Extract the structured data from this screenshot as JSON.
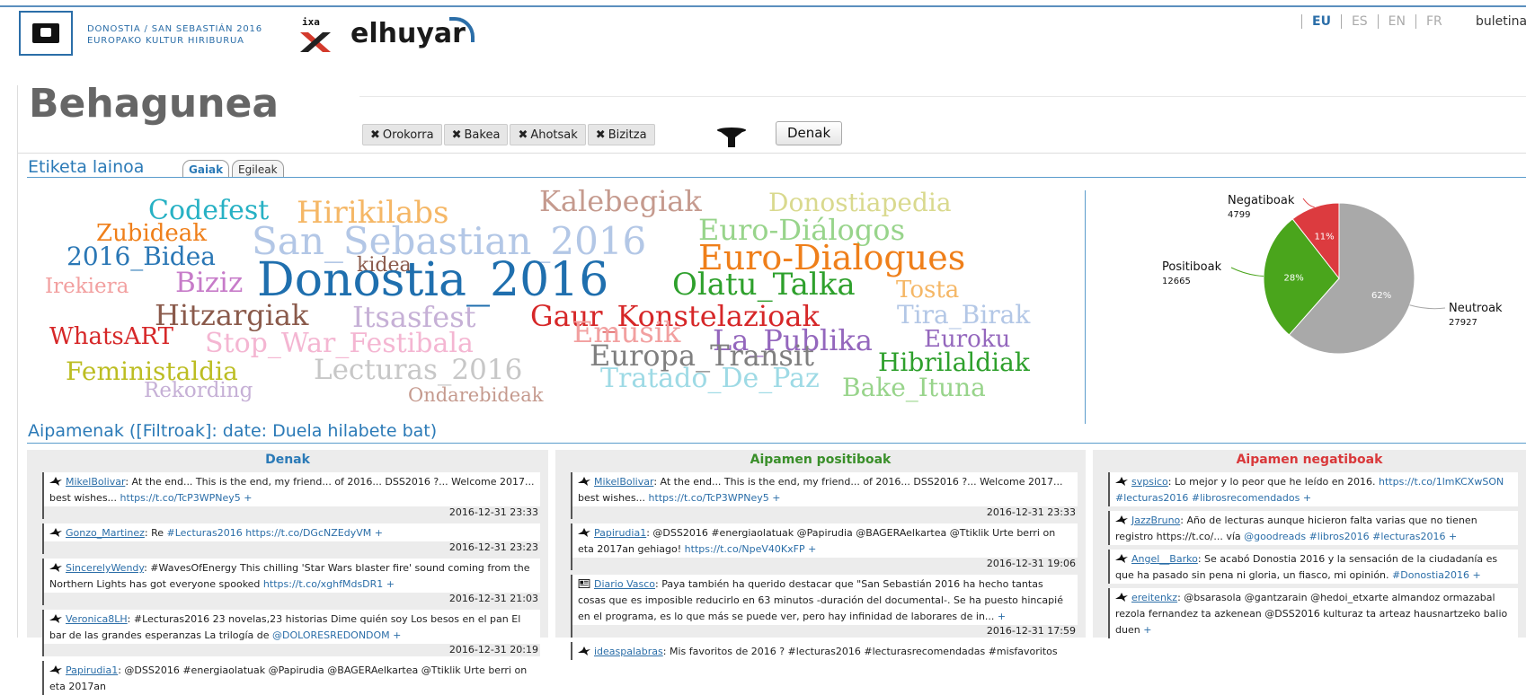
{
  "header": {
    "capital_line1": "DONOSTIA / SAN SEBASTIÁN 2016",
    "capital_line2": "EUROPAKO KULTUR HIRIBURUA",
    "partner_small": "ixa",
    "partner_name": "elhuyar",
    "languages": [
      "EU",
      "ES",
      "EN",
      "FR"
    ],
    "active_language": "EU",
    "newsletter": "buletina"
  },
  "page_title": "Behagunea",
  "filters": [
    "Orokorra",
    "Bakea",
    "Ahotsak",
    "Bizitza"
  ],
  "denak_button": "Denak",
  "tagcloud": {
    "title": "Etiketa lainoa",
    "tabs": [
      "Gaiak",
      "Egileak"
    ],
    "active_tab": "Gaiak",
    "words": [
      {
        "text": "Codefest",
        "color": "#27b1c4"
      },
      {
        "text": "Hirikilabs",
        "color": "#f5b766"
      },
      {
        "text": "Kalebegiak",
        "color": "#c59a8e"
      },
      {
        "text": "Donostiapedia",
        "color": "#d9d98e"
      },
      {
        "text": "Zubideak",
        "color": "#ef7f1a"
      },
      {
        "text": "San_Sebastian_2016",
        "color": "#b3c7e6"
      },
      {
        "text": "Euro-Diálogos",
        "color": "#98d48b"
      },
      {
        "text": "2016_Bidea",
        "color": "#2a77b5"
      },
      {
        "text": "kidea",
        "color": "#8a5a4b"
      },
      {
        "text": "Euro-Dialogues",
        "color": "#ef7f1a"
      },
      {
        "text": "Irekiera",
        "color": "#f2a0a0"
      },
      {
        "text": "Biziz",
        "color": "#c77cc9"
      },
      {
        "text": "Donostia_2016",
        "color": "#1f6fae"
      },
      {
        "text": "Olatu_Talka",
        "color": "#2ea02c"
      },
      {
        "text": "Tosta",
        "color": "#f5b766"
      },
      {
        "text": "Hitzargiak",
        "color": "#8a5a4b"
      },
      {
        "text": "Itsasfest",
        "color": "#c6b0d6"
      },
      {
        "text": "Gaur_Konstelazioak",
        "color": "#d62728"
      },
      {
        "text": "Tira_Birak",
        "color": "#b3c7e6"
      },
      {
        "text": "WhatsART",
        "color": "#d62728"
      },
      {
        "text": "Stop_War_Festibala",
        "color": "#f4b6d2"
      },
      {
        "text": "Emusik",
        "color": "#f2a0a0"
      },
      {
        "text": "La_Publika",
        "color": "#9467bd"
      },
      {
        "text": "Euroku",
        "color": "#9467bd"
      },
      {
        "text": "Europa_Transit",
        "color": "#7f7f7f"
      },
      {
        "text": "Tratado_De_Paz",
        "color": "#9edae5"
      },
      {
        "text": "Hibrilaldiak",
        "color": "#2ea02c"
      },
      {
        "text": "Feministaldia",
        "color": "#bcbd22"
      },
      {
        "text": "Lecturas_2016",
        "color": "#c7c7c7"
      },
      {
        "text": "Bake_Ituna",
        "color": "#98d48b"
      },
      {
        "text": "Rekording",
        "color": "#c6b0d6"
      },
      {
        "text": "Ondarebideak",
        "color": "#c59a8e"
      }
    ]
  },
  "chart_data": {
    "type": "pie",
    "slices": [
      {
        "label": "Neutroak",
        "value": 27927,
        "percent": "62%",
        "color": "#a9a9a9"
      },
      {
        "label": "Positiboak",
        "value": 12665,
        "percent": "28%",
        "color": "#4aa51c"
      },
      {
        "label": "Negatiboak",
        "value": 4799,
        "percent": "11%",
        "color": "#dc3b3f"
      }
    ]
  },
  "mentions": {
    "title": "Aipamenak ([Filtroak]: date: Duela hilabete bat)",
    "columns": [
      {
        "heading": "Denak",
        "color": "#2b7ab7",
        "tweets": [
          {
            "user": "MikelBolivar",
            "text": ": At the end... This is the end, my friend... of 2016... DSS2016 ?... Welcome 2017... best wishes... ",
            "link": "https://t.co/TcP3WPNey5 +",
            "date": "2016-12-31 23:33"
          },
          {
            "user": "Gonzo_Martinez",
            "text": ": Re ",
            "link": "#Lecturas2016 https://t.co/DGcNZEdyVM +",
            "date": "2016-12-31 23:23"
          },
          {
            "user": "SincerelyWendy",
            "text": ": #WavesOfEnergy This chilling 'Star Wars blaster fire' sound coming from the Northern Lights has got everyone spooked ",
            "link": "https://t.co/xghfMdsDR1 +",
            "date": "2016-12-31 21:03"
          },
          {
            "user": "Veronica8LH",
            "text": ": #Lecturas2016 23 novelas,23 historias Dime quién soy Los besos en el pan El bar de las grandes esperanzas La trilogía de ",
            "link": "@DOLORESREDONDOM +",
            "date": "2016-12-31 20:19"
          },
          {
            "user": "Papirudia1",
            "text": ": @DSS2016 #energiaolatuak @Papirudia @BAGERAelkartea @Ttiklik Urte berri on eta 2017an",
            "link": "",
            "date": ""
          }
        ]
      },
      {
        "heading": "Aipamen positiboak",
        "color": "#3a8f2a",
        "tweets": [
          {
            "user": "MikelBolivar",
            "text": ": At the end... This is the end, my friend... of 2016... DSS2016 ?... Welcome 2017... best wishes... ",
            "link": "https://t.co/TcP3WPNey5 +",
            "date": "2016-12-31 23:33"
          },
          {
            "user": "Papirudia1",
            "text": ": @DSS2016 #energiaolatuak @Papirudia @BAGERAelkartea @Ttiklik Urte berri on eta 2017an gehiago! ",
            "link": "https://t.co/NpeV40KxFP +",
            "date": "2016-12-31 19:06"
          },
          {
            "user": "Diario Vasco",
            "text": ": Paya también ha querido destacar que \"San Sebastián 2016 ha hecho tantas cosas que es imposible reducirlo en 63 minutos -duración del documental-. Se ha puesto hincapié en el programa, es lo que más se puede ver, pero hay infinidad de laborares de in... ",
            "link": "+",
            "date": "2016-12-31 17:59"
          },
          {
            "user": "ideaspalabras",
            "text": ": Mis favoritos de 2016 ? #lecturas2016 #lecturasrecomendadas #misfavoritos",
            "link": "",
            "date": ""
          }
        ]
      },
      {
        "heading": "Aipamen negatiboak",
        "color": "#d9383a",
        "tweets": [
          {
            "user": "svpsico",
            "text": ": Lo mejor y lo peor que he leído en 2016. ",
            "link": "https://t.co/1lmKCXwSON #lecturas2016 #librosrecomendados +",
            "date": ""
          },
          {
            "user": "JazzBruno",
            "text": ": Año de lecturas aunque hicieron falta varias que no tienen registro https://t.co/... vía ",
            "link": "@goodreads #libros2016 #lecturas2016 +",
            "date": ""
          },
          {
            "user": "Angel__Barko",
            "text": ": Se acabó Donostia 2016 y la sensación de la ciudadanía es que ha pasado sin pena ni gloria, un fiasco, mi opinión. ",
            "link": "#Donostia2016 +",
            "date": ""
          },
          {
            "user": "ereitenkz",
            "text": ": @bsarasola @gantzarain @hedoi_etxarte almandoz ormazabal rezola fernandez ta azkenean @DSS2016 kulturaz ta arteaz hausnartzeko balio duen ",
            "link": "+",
            "date": ""
          }
        ]
      }
    ]
  }
}
